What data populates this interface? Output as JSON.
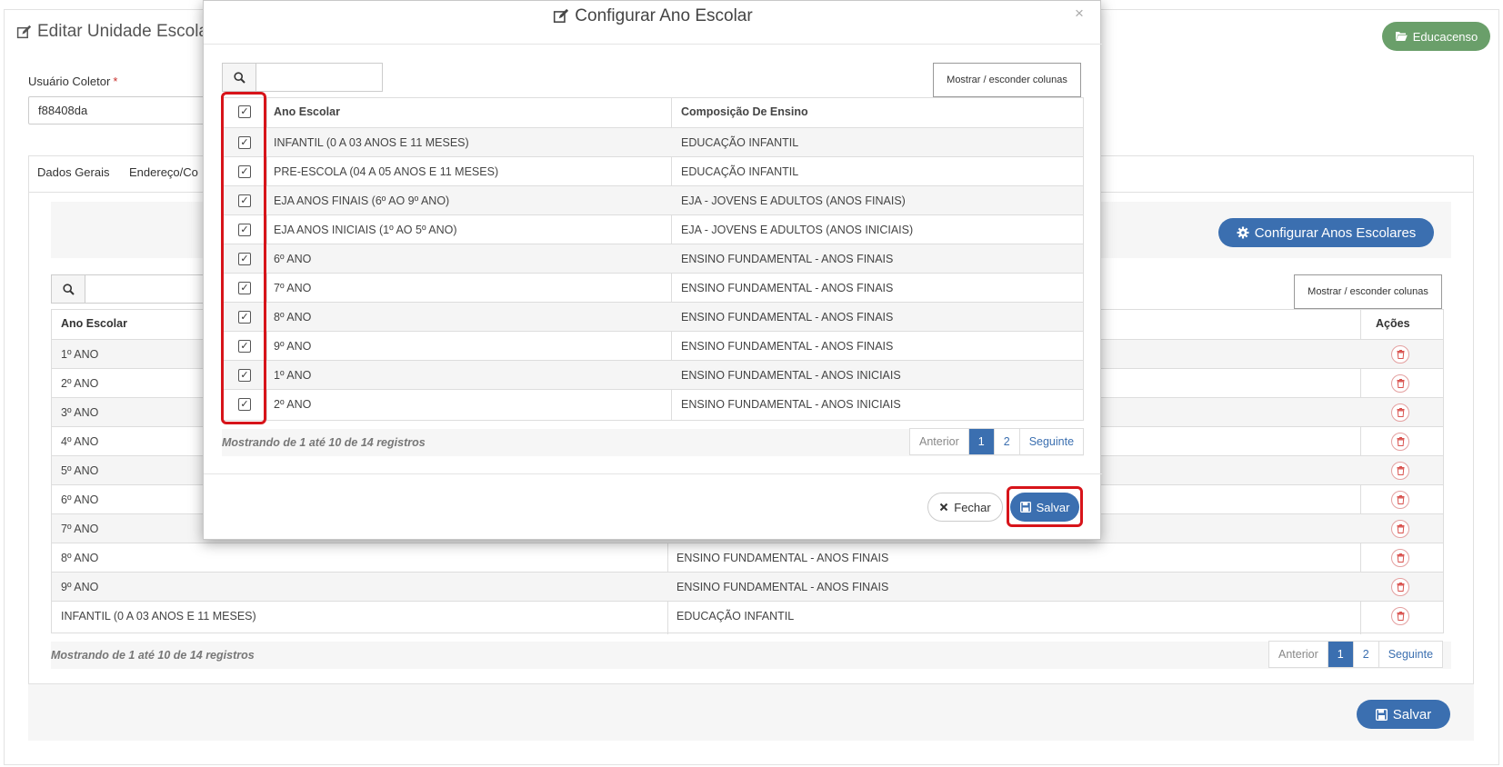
{
  "page": {
    "title": "Editar Unidade Escolar",
    "educacenso_label": "Educacenso",
    "collector_label": "Usuário Coletor",
    "collector_required": "*",
    "collector_value": "f88408da",
    "tabs": [
      "Dados Gerais",
      "Endereço/Co"
    ],
    "config_button_label": "Configurar Anos Escolares",
    "show_hide_columns_label": "Mostrar / esconder colunas",
    "table_headers": {
      "ano_escolar": "Ano Escolar",
      "acoes": "Ações"
    },
    "rows": [
      {
        "ano": "1º ANO",
        "composicao": ""
      },
      {
        "ano": "2º ANO",
        "composicao": ""
      },
      {
        "ano": "3º ANO",
        "composicao": ""
      },
      {
        "ano": "4º ANO",
        "composicao": ""
      },
      {
        "ano": "5º ANO",
        "composicao": ""
      },
      {
        "ano": "6º ANO",
        "composicao": ""
      },
      {
        "ano": "7º ANO",
        "composicao": ""
      },
      {
        "ano": "8º ANO",
        "composicao": "ENSINO FUNDAMENTAL - ANOS FINAIS"
      },
      {
        "ano": "9º ANO",
        "composicao": "ENSINO FUNDAMENTAL - ANOS FINAIS"
      },
      {
        "ano": "INFANTIL (0 A 03 ANOS E 11 MESES)",
        "composicao": "EDUCAÇÃO INFANTIL"
      }
    ],
    "info_text": "Mostrando de 1 até 10 de 14 registros",
    "pager": {
      "prev": "Anterior",
      "page1": "1",
      "page2": "2",
      "next": "Seguinte"
    },
    "save_label": "Salvar"
  },
  "modal": {
    "title": "Configurar Ano Escolar",
    "close_glyph": "×",
    "show_hide_columns_label": "Mostrar / esconder colunas",
    "table_headers": {
      "ano_escolar": "Ano Escolar",
      "composicao": "Composição De Ensino"
    },
    "rows": [
      {
        "ano": "INFANTIL (0 A 03 ANOS E 11 MESES)",
        "composicao": "EDUCAÇÃO INFANTIL",
        "checked": true
      },
      {
        "ano": "PRE-ESCOLA (04 A 05 ANOS E 11 MESES)",
        "composicao": "EDUCAÇÃO INFANTIL",
        "checked": true
      },
      {
        "ano": "EJA ANOS FINAIS (6º AO 9º ANO)",
        "composicao": "EJA - JOVENS E ADULTOS (ANOS FINAIS)",
        "checked": true
      },
      {
        "ano": "EJA ANOS INICIAIS (1º AO 5º ANO)",
        "composicao": "EJA - JOVENS E ADULTOS (ANOS INICIAIS)",
        "checked": true
      },
      {
        "ano": "6º ANO",
        "composicao": "ENSINO FUNDAMENTAL - ANOS FINAIS",
        "checked": true
      },
      {
        "ano": "7º ANO",
        "composicao": "ENSINO FUNDAMENTAL - ANOS FINAIS",
        "checked": true
      },
      {
        "ano": "8º ANO",
        "composicao": "ENSINO FUNDAMENTAL - ANOS FINAIS",
        "checked": true
      },
      {
        "ano": "9º ANO",
        "composicao": "ENSINO FUNDAMENTAL - ANOS FINAIS",
        "checked": true
      },
      {
        "ano": "1º ANO",
        "composicao": "ENSINO FUNDAMENTAL - ANOS INICIAIS",
        "checked": true
      },
      {
        "ano": "2º ANO",
        "composicao": "ENSINO FUNDAMENTAL - ANOS INICIAIS",
        "checked": true
      }
    ],
    "info_text": "Mostrando de 1 até 10 de 14 registros",
    "pager": {
      "prev": "Anterior",
      "page1": "1",
      "page2": "2",
      "next": "Seguinte"
    },
    "close_label": "Fechar",
    "save_label": "Salvar"
  },
  "colors": {
    "primary": "#3b6fb0",
    "success": "#6a9f6a",
    "highlight": "#d7141a",
    "danger": "#d9534f"
  }
}
